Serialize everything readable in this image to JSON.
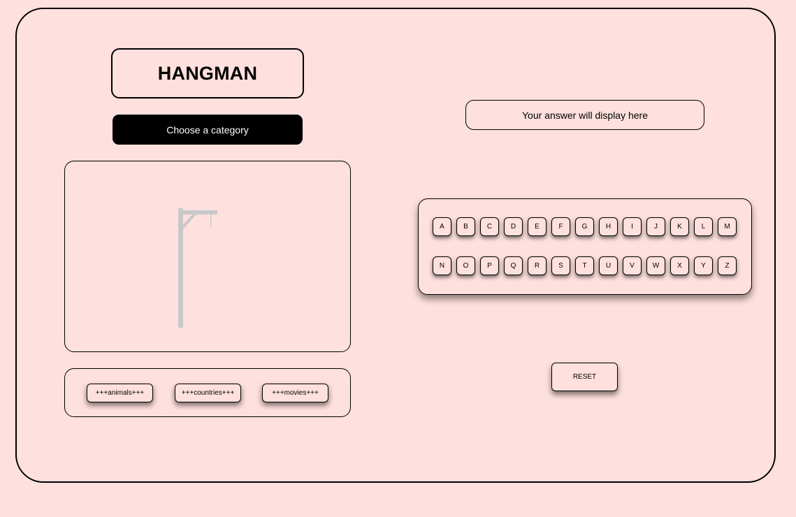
{
  "title": "HANGMAN",
  "category_prompt": "Choose a category",
  "categories": [
    "+++animals+++",
    "+++countries+++",
    "+++movies+++"
  ],
  "answer_placeholder": "Your answer will display here",
  "keyboard": {
    "row1": [
      "A",
      "B",
      "C",
      "D",
      "E",
      "F",
      "G",
      "H",
      "I",
      "J",
      "K",
      "L",
      "M"
    ],
    "row2": [
      "N",
      "O",
      "P",
      "Q",
      "R",
      "S",
      "T",
      "U",
      "V",
      "W",
      "X",
      "Y",
      "Z"
    ]
  },
  "reset_label": "RESET",
  "colors": {
    "background": "#fee0de",
    "gallows": "#c8c8c8",
    "category_bar": "#000000"
  }
}
